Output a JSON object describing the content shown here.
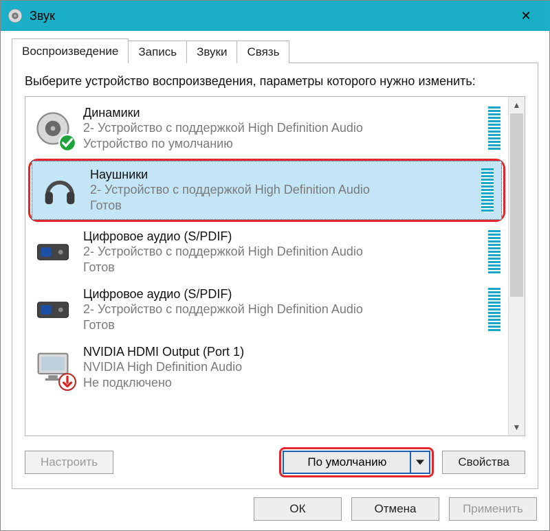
{
  "window": {
    "title": "Звук",
    "close_glyph": "✕"
  },
  "tabs": [
    {
      "label": "Воспроизведение",
      "active": true
    },
    {
      "label": "Запись",
      "active": false
    },
    {
      "label": "Звуки",
      "active": false
    },
    {
      "label": "Связь",
      "active": false
    }
  ],
  "instruction": "Выберите устройство воспроизведения, параметры которого нужно изменить:",
  "devices": [
    {
      "icon": "speaker",
      "badge": "check",
      "title": "Динамики",
      "line2": "2- Устройство с поддержкой High Definition Audio",
      "line3": "Устройство по умолчанию",
      "meter": true,
      "selected": false
    },
    {
      "icon": "headphones",
      "badge": null,
      "title": "Наушники",
      "line2": "2- Устройство с поддержкой High Definition Audio",
      "line3": "Готов",
      "meter": true,
      "selected": true
    },
    {
      "icon": "soundbox",
      "badge": null,
      "title": "Цифровое аудио (S/PDIF)",
      "line2": "2- Устройство с поддержкой High Definition Audio",
      "line3": "Готов",
      "meter": true,
      "selected": false
    },
    {
      "icon": "soundbox",
      "badge": null,
      "title": "Цифровое аудио (S/PDIF)",
      "line2": "2- Устройство с поддержкой High Definition Audio",
      "line3": "Готов",
      "meter": true,
      "selected": false
    },
    {
      "icon": "monitor",
      "badge": "down",
      "title": "NVIDIA HDMI Output (Port 1)",
      "line2": "NVIDIA High Definition Audio",
      "line3": "Не подключено",
      "meter": false,
      "selected": false
    }
  ],
  "bottom": {
    "configure": "Настроить",
    "set_default": "По умолчанию",
    "properties": "Свойства"
  },
  "dialog_buttons": {
    "ok": "ОК",
    "cancel": "Отмена",
    "apply": "Применить"
  },
  "scroll": {
    "up": "▲",
    "down": "▼"
  }
}
